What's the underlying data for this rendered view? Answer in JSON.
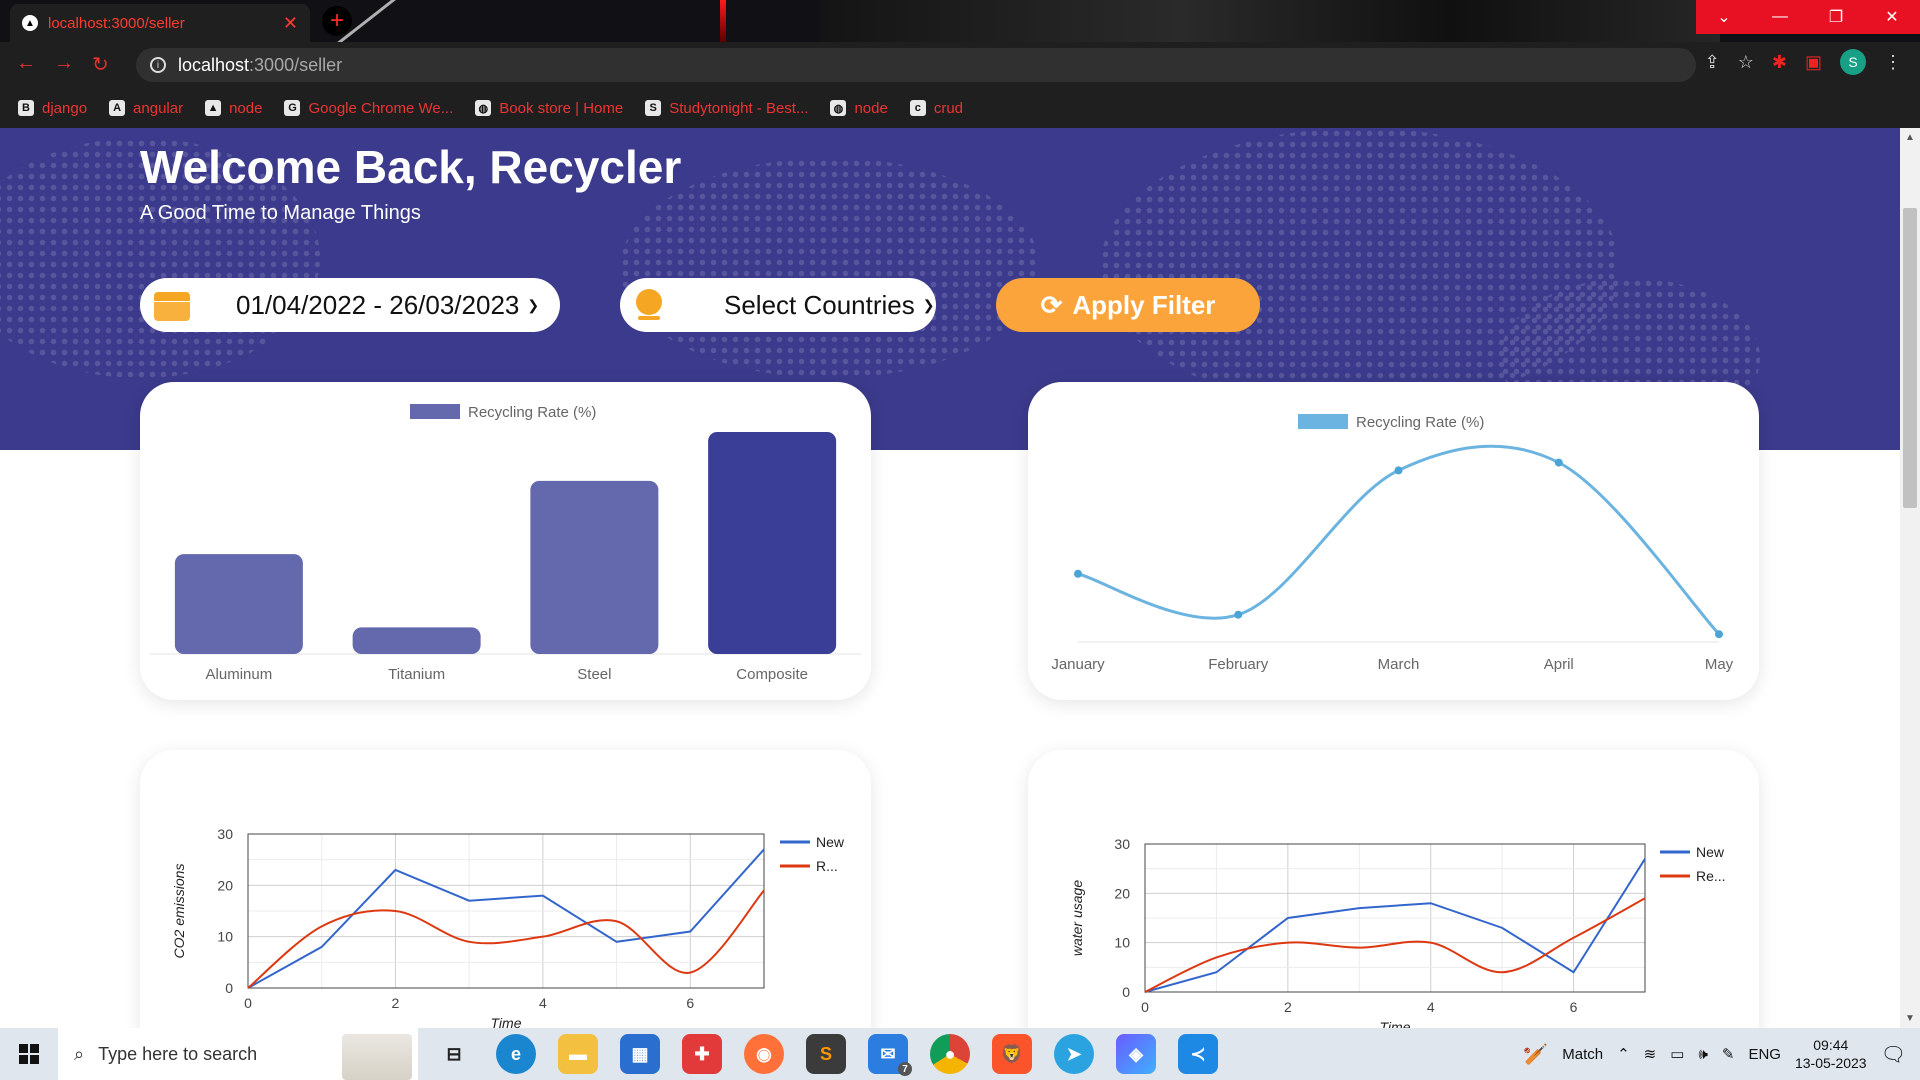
{
  "browser": {
    "tab_title": "localhost:3000/seller",
    "url_host": "localhost",
    "url_path": ":3000/seller",
    "bookmarks": [
      {
        "icon": "B",
        "label": "django"
      },
      {
        "icon": "A",
        "label": "angular"
      },
      {
        "icon": "▲",
        "label": "node"
      },
      {
        "icon": "G",
        "label": "Google Chrome We..."
      },
      {
        "icon": "◍",
        "label": "Book store | Home"
      },
      {
        "icon": "S",
        "label": "Studytonight - Best..."
      },
      {
        "icon": "◍",
        "label": "node"
      },
      {
        "icon": "c",
        "label": "crud"
      }
    ],
    "profile_initial": "S"
  },
  "page": {
    "welcome": "Welcome Back, Recycler",
    "subtitle": "A Good Time to Manage Things",
    "date_range": "01/04/2022 - 26/03/2023",
    "countries_label": "Select Countries",
    "apply_label": "Apply Filter",
    "icons": {
      "date": "calendar-icon",
      "countries": "globe-icon",
      "apply": "refresh-icon"
    }
  },
  "colors": {
    "hero_bg": "#3b3a8c",
    "bar_fill": "#6468ac",
    "bar_highlight": "#3a3e96",
    "line_curve": "#6bb3e0",
    "series_new": "#3366cc",
    "series_re": "#dc3912",
    "apply_button": "#fba43c"
  },
  "chart_data": [
    {
      "type": "bar",
      "legend": "Recycling Rate (%)",
      "categories": [
        "Aluminum",
        "Titanium",
        "Steel",
        "Composite"
      ],
      "values": [
        45,
        12,
        78,
        100
      ],
      "ylim": [
        0,
        100
      ],
      "grid": false,
      "legend_position": "top"
    },
    {
      "type": "line",
      "legend": "Recycling Rate (%)",
      "categories": [
        "January",
        "February",
        "March",
        "April",
        "May"
      ],
      "values": [
        35,
        14,
        88,
        92,
        4
      ],
      "ylim": [
        0,
        100
      ],
      "smooth": true,
      "grid": false,
      "legend_position": "top"
    },
    {
      "type": "line",
      "xlabel": "Time",
      "ylabel": "CO2 emissions",
      "x": [
        0,
        1,
        2,
        3,
        4,
        5,
        6,
        7
      ],
      "xlim": [
        0,
        7
      ],
      "ylim": [
        0,
        30
      ],
      "xticks": [
        0,
        2,
        4,
        6
      ],
      "yticks": [
        0,
        10,
        20,
        30
      ],
      "grid": true,
      "legend_position": "right",
      "series": [
        {
          "name": "New",
          "values": [
            0,
            8,
            23,
            17,
            18,
            9,
            11,
            27
          ]
        },
        {
          "name": "R...",
          "values": [
            0,
            12,
            15,
            9,
            10,
            13,
            3,
            19
          ],
          "smooth": true
        }
      ]
    },
    {
      "type": "line",
      "xlabel": "Time",
      "ylabel": "water usage",
      "x": [
        0,
        1,
        2,
        3,
        4,
        5,
        6,
        7
      ],
      "xlim": [
        0,
        7
      ],
      "ylim": [
        0,
        30
      ],
      "xticks": [
        0,
        2,
        4,
        6
      ],
      "yticks": [
        0,
        10,
        20,
        30
      ],
      "grid": true,
      "legend_position": "right",
      "series": [
        {
          "name": "New",
          "values": [
            0,
            4,
            15,
            17,
            18,
            13,
            4,
            27
          ]
        },
        {
          "name": "Re...",
          "values": [
            0,
            7,
            10,
            9,
            10,
            4,
            11,
            19
          ],
          "smooth": true
        }
      ]
    }
  ],
  "taskbar": {
    "search_placeholder": "Type here to search",
    "apps": [
      "task-view-icon",
      "edge-icon",
      "file-explorer-icon",
      "store-icon",
      "gift-icon",
      "firefox-icon",
      "sublime-icon",
      "mail-icon",
      "chrome-icon",
      "brave-icon",
      "telegram-icon",
      "copilot-icon",
      "vscode-icon"
    ],
    "mail_badge": "7",
    "weather_label": "Match",
    "language": "ENG",
    "time": "09:44",
    "date": "13-05-2023"
  }
}
